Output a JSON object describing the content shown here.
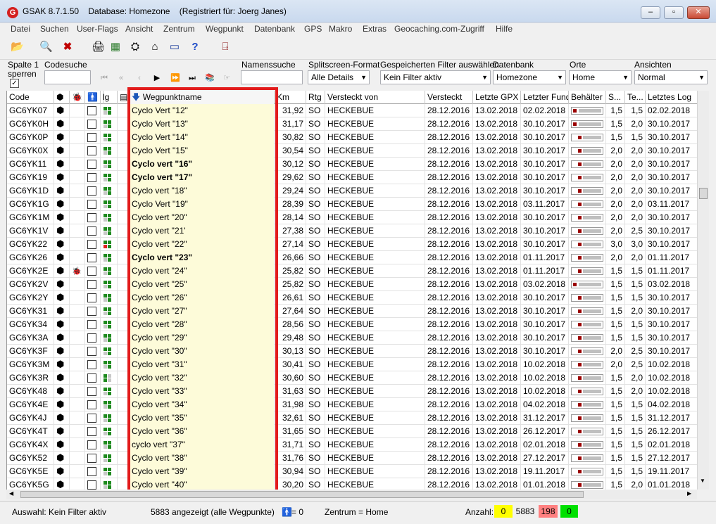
{
  "window": {
    "title": "GSAK 8.7.1.50    Database: Homezone    (Registriert für: Joerg Janes)"
  },
  "menu": [
    "Datei",
    "Suchen",
    "User-Flags",
    "Ansicht",
    "Zentrum",
    "Wegpunkt",
    "Datenbank",
    "GPS",
    "Makro",
    "Extras",
    "Geocaching.com-Zugriff",
    "Hilfe"
  ],
  "filters": {
    "spalte_label1": "Spalte 1",
    "spalte_label2": "sperren",
    "codesuche_label": "Codesuche",
    "namenssuche_label": "Namenssuche",
    "splitscreen_label": "Splitscreen-Format",
    "splitscreen_value": "Alle Details",
    "filter_label": "Gespeicherten Filter auswählen",
    "filter_value": "Kein Filter aktiv",
    "db_label": "Datenbank",
    "db_value": "Homezone",
    "orte_label": "Orte",
    "orte_value": "Home",
    "ansichten_label": "Ansichten",
    "ansichten_value": "Normal"
  },
  "columns": [
    "Code",
    "",
    "",
    "",
    "",
    "lg",
    "",
    "Wegpunktname",
    "Km",
    "Rtg",
    "Versteckt von",
    "Versteckt",
    "Letzte GPX",
    "Letzter Fund",
    "Behälter",
    "S...",
    "Te...",
    "Letztes Log"
  ],
  "rows": [
    {
      "code": "GC6YK07",
      "name": "Cyclo Vert \"12\"",
      "bold": false,
      "km": "31,92",
      "rtg": "SO",
      "owner": "HECKEBUE",
      "hidden": "28.12.2016",
      "gpx": "13.02.2018",
      "found": "02.02.2018",
      "cont": 1,
      "s": "1,5",
      "t": "1,5",
      "log": "02.02.2018",
      "gpxicon": false,
      "flag": "g"
    },
    {
      "code": "GC6YK0H",
      "name": "Cyclo Vert \"13\"",
      "bold": false,
      "km": "31,17",
      "rtg": "SO",
      "owner": "HECKEBUE",
      "hidden": "28.12.2016",
      "gpx": "13.02.2018",
      "found": "30.10.2017",
      "cont": 1,
      "s": "1,5",
      "t": "2,0",
      "log": "30.10.2017",
      "gpxicon": false,
      "flag": "g"
    },
    {
      "code": "GC6YK0P",
      "name": "Cyclo Vert \"14\"",
      "bold": false,
      "km": "30,82",
      "rtg": "SO",
      "owner": "HECKEBUE",
      "hidden": "28.12.2016",
      "gpx": "13.02.2018",
      "found": "30.10.2017",
      "cont": 2,
      "s": "1,5",
      "t": "1,5",
      "log": "30.10.2017",
      "gpxicon": false,
      "flag": "g"
    },
    {
      "code": "GC6YK0X",
      "name": "Cyclo Vert \"15\"",
      "bold": false,
      "km": "30,54",
      "rtg": "SO",
      "owner": "HECKEBUE",
      "hidden": "28.12.2016",
      "gpx": "13.02.2018",
      "found": "30.10.2017",
      "cont": 2,
      "s": "2,0",
      "t": "2,0",
      "log": "30.10.2017",
      "gpxicon": false,
      "flag": "g"
    },
    {
      "code": "GC6YK11",
      "name": "Cyclo vert \"16\"",
      "bold": true,
      "km": "30,12",
      "rtg": "SO",
      "owner": "HECKEBUE",
      "hidden": "28.12.2016",
      "gpx": "13.02.2018",
      "found": "30.10.2017",
      "cont": 2,
      "s": "2,0",
      "t": "2,0",
      "log": "30.10.2017",
      "gpxicon": false,
      "flag": "g"
    },
    {
      "code": "GC6YK19",
      "name": "Cyclo vert \"17\"",
      "bold": true,
      "km": "29,62",
      "rtg": "SO",
      "owner": "HECKEBUE",
      "hidden": "28.12.2016",
      "gpx": "13.02.2018",
      "found": "30.10.2017",
      "cont": 2,
      "s": "2,0",
      "t": "2,0",
      "log": "30.10.2017",
      "gpxicon": false,
      "flag": "g"
    },
    {
      "code": "GC6YK1D",
      "name": "Cyclo vert \"18\"",
      "bold": false,
      "km": "29,24",
      "rtg": "SO",
      "owner": "HECKEBUE",
      "hidden": "28.12.2016",
      "gpx": "13.02.2018",
      "found": "30.10.2017",
      "cont": 2,
      "s": "2,0",
      "t": "2,0",
      "log": "30.10.2017",
      "gpxicon": false,
      "flag": "g"
    },
    {
      "code": "GC6YK1G",
      "name": "Cyclo Vert \"19\"",
      "bold": false,
      "km": "28,39",
      "rtg": "SO",
      "owner": "HECKEBUE",
      "hidden": "28.12.2016",
      "gpx": "13.02.2018",
      "found": "03.11.2017",
      "cont": 2,
      "s": "2,0",
      "t": "2,0",
      "log": "03.11.2017",
      "gpxicon": false,
      "flag": "g"
    },
    {
      "code": "GC6YK1M",
      "name": "Cyclo vert \"20\"",
      "bold": false,
      "km": "28,14",
      "rtg": "SO",
      "owner": "HECKEBUE",
      "hidden": "28.12.2016",
      "gpx": "13.02.2018",
      "found": "30.10.2017",
      "cont": 2,
      "s": "2,0",
      "t": "2,0",
      "log": "30.10.2017",
      "gpxicon": false,
      "flag": "g"
    },
    {
      "code": "GC6YK1V",
      "name": "Cyclo vert \"21'",
      "bold": false,
      "km": "27,38",
      "rtg": "SO",
      "owner": "HECKEBUE",
      "hidden": "28.12.2016",
      "gpx": "13.02.2018",
      "found": "30.10.2017",
      "cont": 2,
      "s": "2,0",
      "t": "2,5",
      "log": "30.10.2017",
      "gpxicon": false,
      "flag": "g"
    },
    {
      "code": "GC6YK22",
      "name": "Cyclo vert \"22\"",
      "bold": false,
      "km": "27,14",
      "rtg": "SO",
      "owner": "HECKEBUE",
      "hidden": "28.12.2016",
      "gpx": "13.02.2018",
      "found": "30.10.2017",
      "cont": 2,
      "s": "3,0",
      "t": "3,0",
      "log": "30.10.2017",
      "gpxicon": false,
      "flag": "r"
    },
    {
      "code": "GC6YK26",
      "name": "Cyclo vert \"23\"",
      "bold": true,
      "km": "26,66",
      "rtg": "SO",
      "owner": "HECKEBUE",
      "hidden": "28.12.2016",
      "gpx": "13.02.2018",
      "found": "01.11.2017",
      "cont": 2,
      "s": "2,0",
      "t": "2,0",
      "log": "01.11.2017",
      "gpxicon": false,
      "flag": "g"
    },
    {
      "code": "GC6YK2E",
      "name": "Cyclo vert \"24\"",
      "bold": false,
      "km": "25,82",
      "rtg": "SO",
      "owner": "HECKEBUE",
      "hidden": "28.12.2016",
      "gpx": "13.02.2018",
      "found": "01.11.2017",
      "cont": 2,
      "s": "1,5",
      "t": "1,5",
      "log": "01.11.2017",
      "gpxicon": true,
      "flag": "g"
    },
    {
      "code": "GC6YK2V",
      "name": "Cyclo vert \"25\"",
      "bold": false,
      "km": "25,82",
      "rtg": "SO",
      "owner": "HECKEBUE",
      "hidden": "28.12.2016",
      "gpx": "13.02.2018",
      "found": "03.02.2018",
      "cont": 1,
      "s": "1,5",
      "t": "1,5",
      "log": "03.02.2018",
      "gpxicon": false,
      "flag": "g"
    },
    {
      "code": "GC6YK2Y",
      "name": "Cyclo vert \"26\"",
      "bold": false,
      "km": "26,61",
      "rtg": "SO",
      "owner": "HECKEBUE",
      "hidden": "28.12.2016",
      "gpx": "13.02.2018",
      "found": "30.10.2017",
      "cont": 2,
      "s": "1,5",
      "t": "1,5",
      "log": "30.10.2017",
      "gpxicon": false,
      "flag": "g"
    },
    {
      "code": "GC6YK31",
      "name": "Cyclo vert \"27\"",
      "bold": false,
      "km": "27,64",
      "rtg": "SO",
      "owner": "HECKEBUE",
      "hidden": "28.12.2016",
      "gpx": "13.02.2018",
      "found": "30.10.2017",
      "cont": 2,
      "s": "1,5",
      "t": "2,0",
      "log": "30.10.2017",
      "gpxicon": false,
      "flag": "g"
    },
    {
      "code": "GC6YK34",
      "name": "Cyclo vert \"28\"",
      "bold": false,
      "km": "28,56",
      "rtg": "SO",
      "owner": "HECKEBUE",
      "hidden": "28.12.2016",
      "gpx": "13.02.2018",
      "found": "30.10.2017",
      "cont": 2,
      "s": "1,5",
      "t": "1,5",
      "log": "30.10.2017",
      "gpxicon": false,
      "flag": "g"
    },
    {
      "code": "GC6YK3A",
      "name": "Cyclo vert \"29\"",
      "bold": false,
      "km": "29,48",
      "rtg": "SO",
      "owner": "HECKEBUE",
      "hidden": "28.12.2016",
      "gpx": "13.02.2018",
      "found": "30.10.2017",
      "cont": 2,
      "s": "1,5",
      "t": "1,5",
      "log": "30.10.2017",
      "gpxicon": false,
      "flag": "g"
    },
    {
      "code": "GC6YK3F",
      "name": "Cyclo vert \"30\"",
      "bold": false,
      "km": "30,13",
      "rtg": "SO",
      "owner": "HECKEBUE",
      "hidden": "28.12.2016",
      "gpx": "13.02.2018",
      "found": "30.10.2017",
      "cont": 2,
      "s": "2,0",
      "t": "2,5",
      "log": "30.10.2017",
      "gpxicon": false,
      "flag": "g"
    },
    {
      "code": "GC6YK3M",
      "name": "Cyclo vert \"31\"",
      "bold": false,
      "km": "30,41",
      "rtg": "SO",
      "owner": "HECKEBUE",
      "hidden": "28.12.2016",
      "gpx": "13.02.2018",
      "found": "10.02.2018",
      "cont": 2,
      "s": "2,0",
      "t": "2,5",
      "log": "10.02.2018",
      "gpxicon": false,
      "flag": "g"
    },
    {
      "code": "GC6YK3R",
      "name": "Cyclo vert \"32\"",
      "bold": false,
      "km": "30,60",
      "rtg": "SO",
      "owner": "HECKEBUE",
      "hidden": "28.12.2016",
      "gpx": "13.02.2018",
      "found": "10.02.2018",
      "cont": 2,
      "s": "1,5",
      "t": "2,0",
      "log": "10.02.2018",
      "gpxicon": false,
      "flag": "gr"
    },
    {
      "code": "GC6YK48",
      "name": "Cyclo vert \"33\"",
      "bold": false,
      "km": "31,63",
      "rtg": "SO",
      "owner": "HECKEBUE",
      "hidden": "28.12.2016",
      "gpx": "13.02.2018",
      "found": "10.02.2018",
      "cont": 2,
      "s": "1,5",
      "t": "2,0",
      "log": "10.02.2018",
      "gpxicon": false,
      "flag": "g"
    },
    {
      "code": "GC6YK4E",
      "name": "Cyclo vert \"34\"",
      "bold": false,
      "km": "31,98",
      "rtg": "SO",
      "owner": "HECKEBUE",
      "hidden": "28.12.2016",
      "gpx": "13.02.2018",
      "found": "04.02.2018",
      "cont": 2,
      "s": "1,5",
      "t": "1,5",
      "log": "04.02.2018",
      "gpxicon": false,
      "flag": "g"
    },
    {
      "code": "GC6YK4J",
      "name": "Cyclo vert \"35\"",
      "bold": false,
      "km": "32,61",
      "rtg": "SO",
      "owner": "HECKEBUE",
      "hidden": "28.12.2016",
      "gpx": "13.02.2018",
      "found": "31.12.2017",
      "cont": 2,
      "s": "1,5",
      "t": "1,5",
      "log": "31.12.2017",
      "gpxicon": false,
      "flag": "g"
    },
    {
      "code": "GC6YK4T",
      "name": "Cyclo vert \"36\"",
      "bold": false,
      "km": "31,65",
      "rtg": "SO",
      "owner": "HECKEBUE",
      "hidden": "28.12.2016",
      "gpx": "13.02.2018",
      "found": "26.12.2017",
      "cont": 2,
      "s": "1,5",
      "t": "1,5",
      "log": "26.12.2017",
      "gpxicon": false,
      "flag": "g"
    },
    {
      "code": "GC6YK4X",
      "name": "cyclo vert \"37\"",
      "bold": false,
      "km": "31,71",
      "rtg": "SO",
      "owner": "HECKEBUE",
      "hidden": "28.12.2016",
      "gpx": "13.02.2018",
      "found": "02.01.2018",
      "cont": 2,
      "s": "1,5",
      "t": "1,5",
      "log": "02.01.2018",
      "gpxicon": false,
      "flag": "g"
    },
    {
      "code": "GC6YK52",
      "name": "Cyclo vert \"38\"",
      "bold": false,
      "km": "31,76",
      "rtg": "SO",
      "owner": "HECKEBUE",
      "hidden": "28.12.2016",
      "gpx": "13.02.2018",
      "found": "27.12.2017",
      "cont": 2,
      "s": "1,5",
      "t": "1,5",
      "log": "27.12.2017",
      "gpxicon": false,
      "flag": "g"
    },
    {
      "code": "GC6YK5E",
      "name": "Cyclo vert \"39\"",
      "bold": false,
      "km": "30,94",
      "rtg": "SO",
      "owner": "HECKEBUE",
      "hidden": "28.12.2016",
      "gpx": "13.02.2018",
      "found": "19.11.2017",
      "cont": 2,
      "s": "1,5",
      "t": "1,5",
      "log": "19.11.2017",
      "gpxicon": false,
      "flag": "g"
    },
    {
      "code": "GC6YK5G",
      "name": "Cyclo vert \"40\"",
      "bold": false,
      "km": "30,20",
      "rtg": "SO",
      "owner": "HECKEBUE",
      "hidden": "28.12.2016",
      "gpx": "13.02.2018",
      "found": "01.01.2018",
      "cont": 2,
      "s": "1,5",
      "t": "2,0",
      "log": "01.01.2018",
      "gpxicon": false,
      "flag": "g"
    }
  ],
  "status": {
    "filter": "Auswahl: Kein Filter aktiv",
    "count": "5883 angezeigt (alle Wegpunkte)",
    "people": "= 0",
    "center": "Zentrum = Home",
    "anzahl": "Anzahl:",
    "yellow": "0",
    "total": "5883",
    "red": "198",
    "green": "0"
  },
  "colors": {
    "highlight": "#e21b1b",
    "name_bg": "#fdfbd9",
    "yellow": "#ffff00",
    "red": "#ff8080",
    "green": "#00e000"
  }
}
